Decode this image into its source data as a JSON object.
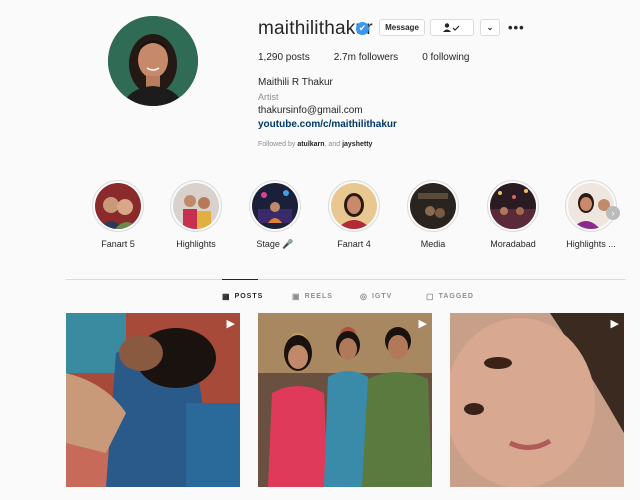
{
  "profile": {
    "username": "maithilithakur",
    "message_label": "Message",
    "stats": {
      "posts": "1,290 posts",
      "followers": "2.7m followers",
      "following": "0 following"
    },
    "full_name": "Maithili R Thakur",
    "category": "Artist",
    "email": "thakursinfo@gmail.com",
    "link": "youtube.com/c/maithilithakur",
    "followed_by_prefix": "Followed by",
    "followed_by_1": "atulkarn",
    "followed_by_sep": ", and",
    "followed_by_2": "jayshetty"
  },
  "highlights": [
    {
      "label": "Fanart 5"
    },
    {
      "label": "Highlights"
    },
    {
      "label": "Stage 🎤"
    },
    {
      "label": "Fanart 4"
    },
    {
      "label": "Media"
    },
    {
      "label": "Moradabad"
    },
    {
      "label": "Highlights ..."
    }
  ],
  "tabs": {
    "posts": "POSTS",
    "reels": "REELS",
    "igtv": "IGTV",
    "tagged": "TAGGED"
  },
  "colors": {
    "verified": "#3897f0",
    "link": "#00376b",
    "muted": "#8e8e8e"
  }
}
